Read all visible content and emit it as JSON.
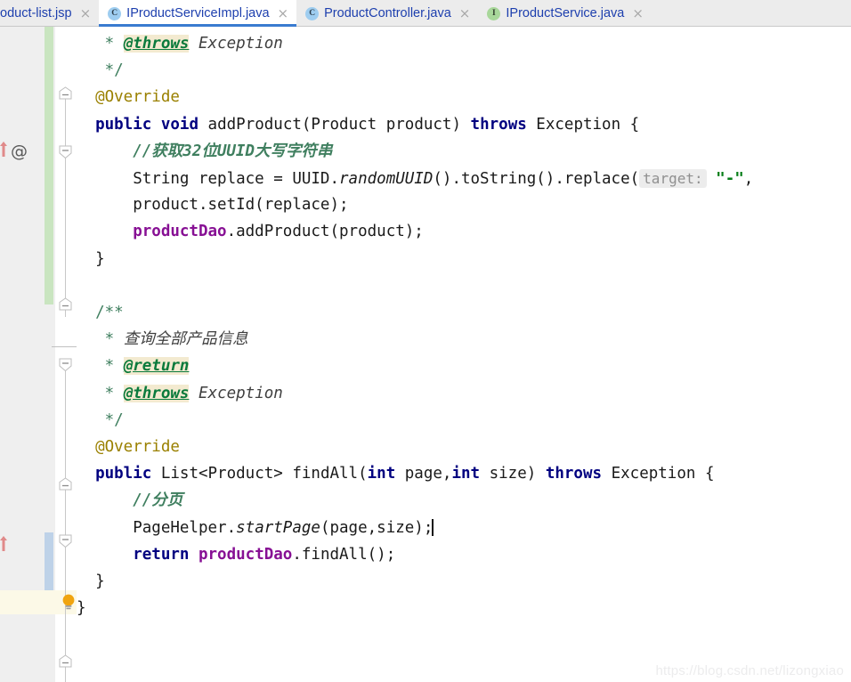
{
  "window": {
    "app": "IntelliJ IDEA editor",
    "watermark": "https://blog.csdn.net/lizongxiao"
  },
  "tabs": [
    {
      "label": "oduct-list.jsp",
      "icon": "",
      "icon_kind": "none",
      "active": false,
      "close": "×"
    },
    {
      "label": "IProductServiceImpl.java",
      "icon": "C",
      "icon_kind": "class",
      "active": true,
      "close": "×"
    },
    {
      "label": "ProductController.java",
      "icon": "C",
      "icon_kind": "class",
      "active": false,
      "close": "×"
    },
    {
      "label": "IProductService.java",
      "icon": "I",
      "icon_kind": "interface",
      "active": false,
      "close": "×"
    }
  ],
  "colors": {
    "tab_text": "#1d3fae",
    "active_tab_underline": "#3a7bd0",
    "keyword": "#000080",
    "comment": "#3f7f5f",
    "annotation": "#9a8000",
    "field": "#871094",
    "string": "#067d17",
    "doctag_highlight": "#f3ead0",
    "current_line": "#fcf9e7",
    "vcs_changed": "#c9e5c0",
    "vcs_modified_block": "#bed2e8",
    "gutter_bg": "#efefef",
    "param_hint_bg": "#ececec"
  },
  "code": {
    "language": "Java",
    "lines": [
      {
        "indent": "   ",
        "tokens": [
          {
            "t": "* ",
            "c": "doc"
          },
          {
            "t": "@throws",
            "c": "doctag"
          },
          {
            "t": " ",
            "c": "doc"
          },
          {
            "t": "Exception",
            "c": "doc-i"
          }
        ]
      },
      {
        "indent": "   ",
        "tokens": [
          {
            "t": "*/",
            "c": "doc"
          }
        ]
      },
      {
        "indent": "  ",
        "tokens": [
          {
            "t": "@Override",
            "c": "anno"
          }
        ]
      },
      {
        "indent": "  ",
        "tokens": [
          {
            "t": "public",
            "c": "kw"
          },
          {
            "t": " ",
            "c": "plain"
          },
          {
            "t": "void",
            "c": "kw"
          },
          {
            "t": " addProduct(Product product) ",
            "c": "plain"
          },
          {
            "t": "throws",
            "c": "kw"
          },
          {
            "t": " Exception {",
            "c": "plain"
          }
        ]
      },
      {
        "indent": "      ",
        "tokens": [
          {
            "t": "//获取32位UUID大写字符串",
            "c": "cmt-b"
          }
        ]
      },
      {
        "indent": "      ",
        "tokens": [
          {
            "t": "String replace = UUID.",
            "c": "plain"
          },
          {
            "t": "randomUUID",
            "c": "mtd"
          },
          {
            "t": "().toString().replace(",
            "c": "plain"
          },
          {
            "t": "target:",
            "c": "hint"
          },
          {
            "t": " ",
            "c": "plain"
          },
          {
            "t": "\"-\"",
            "c": "str"
          },
          {
            "t": ",",
            "c": "plain"
          }
        ]
      },
      {
        "indent": "      ",
        "tokens": [
          {
            "t": "product.setId(replace);",
            "c": "plain"
          }
        ]
      },
      {
        "indent": "      ",
        "tokens": [
          {
            "t": "productDao",
            "c": "field"
          },
          {
            "t": ".addProduct(product);",
            "c": "plain"
          }
        ]
      },
      {
        "indent": "  ",
        "tokens": [
          {
            "t": "}",
            "c": "plain"
          }
        ]
      },
      {
        "indent": "",
        "tokens": []
      },
      {
        "indent": "  ",
        "tokens": [
          {
            "t": "/**",
            "c": "doc"
          }
        ]
      },
      {
        "indent": "   ",
        "tokens": [
          {
            "t": "* ",
            "c": "doc"
          },
          {
            "t": "查询全部产品信息",
            "c": "doc-i"
          }
        ]
      },
      {
        "indent": "   ",
        "tokens": [
          {
            "t": "* ",
            "c": "doc"
          },
          {
            "t": "@return",
            "c": "doctag"
          }
        ]
      },
      {
        "indent": "   ",
        "tokens": [
          {
            "t": "* ",
            "c": "doc"
          },
          {
            "t": "@throws",
            "c": "doctag"
          },
          {
            "t": " ",
            "c": "doc"
          },
          {
            "t": "Exception",
            "c": "doc-i"
          }
        ]
      },
      {
        "indent": "   ",
        "tokens": [
          {
            "t": "*/",
            "c": "doc"
          }
        ]
      },
      {
        "indent": "  ",
        "tokens": [
          {
            "t": "@Override",
            "c": "anno"
          }
        ]
      },
      {
        "indent": "  ",
        "tokens": [
          {
            "t": "public",
            "c": "kw"
          },
          {
            "t": " List<Product> findAll(",
            "c": "plain"
          },
          {
            "t": "int",
            "c": "kw"
          },
          {
            "t": " page,",
            "c": "plain"
          },
          {
            "t": "int",
            "c": "kw"
          },
          {
            "t": " size) ",
            "c": "plain"
          },
          {
            "t": "throws",
            "c": "kw"
          },
          {
            "t": " Exception {",
            "c": "plain"
          }
        ]
      },
      {
        "indent": "      ",
        "tokens": [
          {
            "t": "//分页",
            "c": "cmt-b"
          }
        ]
      },
      {
        "indent": "      ",
        "current": true,
        "tokens": [
          {
            "t": "PageHelper.",
            "c": "plain"
          },
          {
            "t": "startPage",
            "c": "mtd"
          },
          {
            "t": "(page,size);",
            "c": "plain"
          },
          {
            "t": "",
            "c": "caret"
          }
        ]
      },
      {
        "indent": "      ",
        "tokens": [
          {
            "t": "return",
            "c": "kw"
          },
          {
            "t": " ",
            "c": "plain"
          },
          {
            "t": "productDao",
            "c": "field"
          },
          {
            "t": ".findAll();",
            "c": "plain"
          }
        ]
      },
      {
        "indent": "  ",
        "tokens": [
          {
            "t": "}",
            "c": "plain"
          }
        ]
      },
      {
        "indent": "",
        "tokens": [
          {
            "t": "}",
            "c": "plain"
          }
        ]
      }
    ]
  },
  "gutter": {
    "override_marker_label": "@",
    "bulb_tooltip": "intention-action",
    "fold_markers": [
      "collapse",
      "collapse",
      "collapse",
      "collapse",
      "collapse",
      "collapse",
      "collapse"
    ]
  }
}
